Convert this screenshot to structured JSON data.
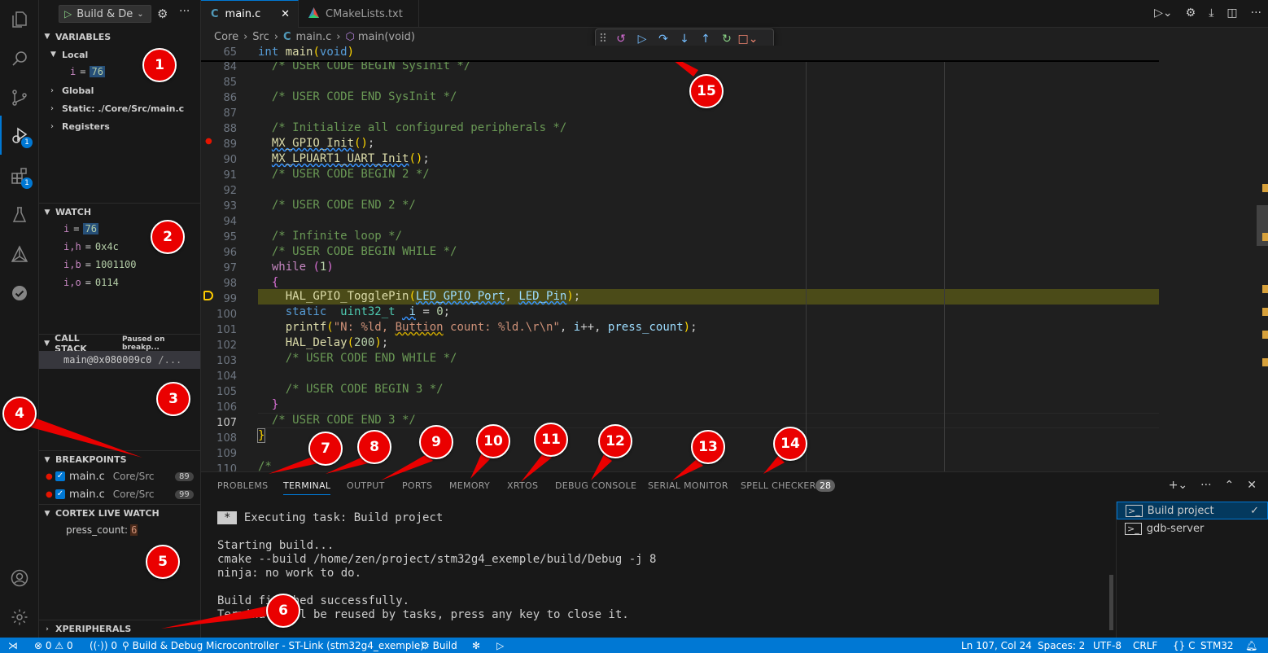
{
  "activity_bar": {
    "items": [
      {
        "name": "explorer-icon"
      },
      {
        "name": "search-icon"
      },
      {
        "name": "source-control-icon"
      },
      {
        "name": "run-debug-icon",
        "badge": "1"
      },
      {
        "name": "extensions-icon",
        "badge": "1"
      },
      {
        "name": "testing-icon"
      },
      {
        "name": "cmake-icon"
      },
      {
        "name": "tasks-check-icon"
      }
    ],
    "accounts": "accounts-icon",
    "manage": "gear-icon"
  },
  "sidebar": {
    "launch_config": "Build & De",
    "variables": {
      "header": "VARIABLES",
      "local_label": "Local",
      "local_var": {
        "name": "i",
        "eq": "=",
        "value": "76"
      },
      "global_label": "Global",
      "static_label": "Static: ./Core/Src/main.c",
      "registers_label": "Registers"
    },
    "watch": {
      "header": "WATCH",
      "items": [
        {
          "name": "i",
          "value": "76"
        },
        {
          "name": "i,h",
          "value": "0x4c"
        },
        {
          "name": "i,b",
          "value": "1001100"
        },
        {
          "name": "i,o",
          "value": "0114"
        }
      ]
    },
    "call_stack": {
      "header": "CALL STACK",
      "status": "Paused on breakp...",
      "frame": "main@0x080009c0",
      "frame_file": "/..."
    },
    "breakpoints": {
      "header": "BREAKPOINTS",
      "items": [
        {
          "file": "main.c",
          "path": "Core/Src",
          "line": "89"
        },
        {
          "file": "main.c",
          "path": "Core/Src",
          "line": "99"
        }
      ]
    },
    "live_watch": {
      "header": "CORTEX LIVE WATCH",
      "item_name": "press_count:",
      "item_value": "6"
    },
    "xperipherals": {
      "header": "XPERIPHERALS"
    }
  },
  "tabs": [
    {
      "label": "main.c",
      "active": true
    },
    {
      "label": "CMakeLists.txt",
      "active": false
    }
  ],
  "breadcrumb": {
    "parts": [
      "Core",
      "Src",
      "main.c",
      "main(void)"
    ]
  },
  "debug_toolbar": {
    "buttons": [
      "drag-handle-icon",
      "restart-frame-icon",
      "continue-icon",
      "step-over-icon",
      "step-into-icon",
      "step-out-icon",
      "restart-icon",
      "stop-icon"
    ]
  },
  "editor": {
    "sticky": {
      "line": "65",
      "text": "int main(void)"
    },
    "lines": [
      {
        "n": "84"
      },
      {
        "n": "85"
      },
      {
        "n": "86"
      },
      {
        "n": "87"
      },
      {
        "n": "88"
      },
      {
        "n": "89"
      },
      {
        "n": "90"
      },
      {
        "n": "91"
      },
      {
        "n": "92"
      },
      {
        "n": "93"
      },
      {
        "n": "94"
      },
      {
        "n": "95"
      },
      {
        "n": "96"
      },
      {
        "n": "97"
      },
      {
        "n": "98"
      },
      {
        "n": "99"
      },
      {
        "n": "100"
      },
      {
        "n": "101"
      },
      {
        "n": "102"
      },
      {
        "n": "103"
      },
      {
        "n": "104"
      },
      {
        "n": "105"
      },
      {
        "n": "106"
      },
      {
        "n": "107"
      },
      {
        "n": "108"
      },
      {
        "n": "109"
      },
      {
        "n": "110"
      }
    ],
    "code": {
      "l84": "/* USER CODE BEGIN SysInit */",
      "l86": "/* USER CODE END SysInit */",
      "l88": "/* Initialize all configured peripherals */",
      "l89a": "MX_GPIO_Init",
      "l89b": "();",
      "l90a": "MX_LPUART1_UART_Init",
      "l90b": "();",
      "l91": "/* USER CODE BEGIN 2 */",
      "l93": "/* USER CODE END 2 */",
      "l95": "/* Infinite loop */",
      "l96": "/* USER CODE BEGIN WHILE */",
      "l97a": "while",
      "l97b": " (",
      "l97c": "1",
      "l97d": ")",
      "l98": "{",
      "l99a": "HAL_GPIO_TogglePin",
      "l99b": "(",
      "l99c": "LED_GPIO_Port",
      "l99d": ", ",
      "l99e": "LED_Pin",
      "l99f": ");",
      "l100a": "static",
      "l100b": " uint32_t",
      "l100c": " i",
      "l100d": " = ",
      "l100e": "0",
      "l100f": ";",
      "l101a": "printf",
      "l101b": "(",
      "l101c": "\"N: %ld, ",
      "l101d": "Buttion",
      "l101e": " count: %ld.\\r\\n\"",
      "l101f": ", ",
      "l101g": "i",
      "l101h": "++, ",
      "l101i": "press_count",
      "l101j": ");",
      "l102a": "HAL_Delay",
      "l102b": "(",
      "l102c": "200",
      "l102d": ");",
      "l103": "/* USER CODE END WHILE */",
      "l105": "/* USER CODE BEGIN 3 */",
      "l106": "}",
      "l107": "/* USER CODE END 3 */",
      "l108": "}",
      "l110": "/*"
    }
  },
  "panel": {
    "tabs": [
      {
        "label": "PROBLEMS"
      },
      {
        "label": "TERMINAL",
        "active": true
      },
      {
        "label": "OUTPUT"
      },
      {
        "label": "PORTS"
      },
      {
        "label": "MEMORY"
      },
      {
        "label": "XRTOS"
      },
      {
        "label": "DEBUG CONSOLE"
      },
      {
        "label": "SERIAL MONITOR"
      },
      {
        "label": "SPELL CHECKER",
        "badge": "28"
      }
    ],
    "terminal": {
      "task_marker": "*",
      "task": "Executing task: Build project",
      "lines": [
        "Starting build...",
        "cmake --build /home/zen/project/stm32g4_exemple/build/Debug -j 8",
        "ninja: no work to do.",
        "",
        "Build finished successfully.",
        "Terminal will be reused by tasks, press any key to close it."
      ]
    },
    "terminal_list": [
      {
        "label": "Build project",
        "selected": true
      },
      {
        "label": "gdb-server",
        "selected": false
      }
    ]
  },
  "status_bar": {
    "errors": "0",
    "warnings": "0",
    "ports": "0",
    "launch": "Build & Debug Microcontroller - ST-Link (stm32g4_exemple)",
    "build": "Build",
    "position": "Ln 107, Col 24",
    "spaces": "Spaces: 2",
    "encoding": "UTF-8",
    "eol": "CRLF",
    "language": "C",
    "platform": "STM32"
  },
  "markers": [
    "1",
    "2",
    "3",
    "4",
    "5",
    "6",
    "7",
    "8",
    "9",
    "10",
    "11",
    "12",
    "13",
    "14",
    "15"
  ],
  "colors": {
    "accent": "#0078d4",
    "marker": "#ea0000",
    "breakpoint": "#e51400",
    "current_line": "#4b4b18"
  }
}
